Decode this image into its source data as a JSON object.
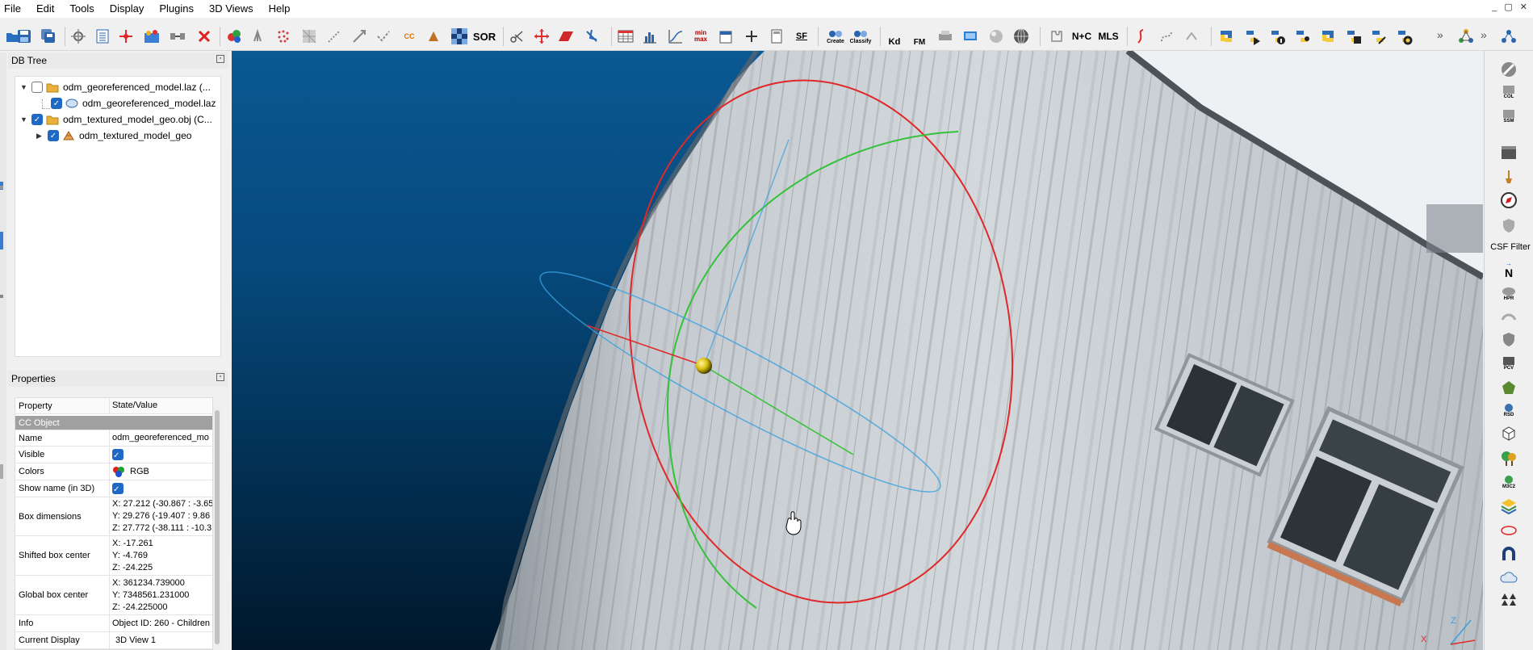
{
  "menu": [
    "File",
    "Edit",
    "Tools",
    "Display",
    "Plugins",
    "3D Views",
    "Help"
  ],
  "window_controls": "_ ▢ ✕",
  "toolbar": {
    "sor_label": "SOR",
    "cc_label": "CC",
    "sf_label": "SF",
    "canupo_create": "Create",
    "canupo_classify": "Classify",
    "kd_label": "Kd",
    "fm_label": "FM",
    "nc_label": "N+C",
    "mls_label": "MLS",
    "minmax_label": "min max",
    "more": "»"
  },
  "db_tree": {
    "title": "DB Tree",
    "items": [
      {
        "label": "odm_georeferenced_model.laz (...",
        "checked": false,
        "expanded": true
      },
      {
        "label": "odm_georeferenced_model.laz",
        "checked": true
      },
      {
        "label": "odm_textured_model_geo.obj (C...",
        "checked": true,
        "expanded": true
      },
      {
        "label": "odm_textured_model_geo",
        "checked": true,
        "expanded": false
      }
    ]
  },
  "properties": {
    "title": "Properties",
    "header": {
      "property": "Property",
      "value": "State/Value"
    },
    "section": "CC Object",
    "rows": {
      "name": {
        "label": "Name",
        "value": "odm_georeferenced_mo"
      },
      "visible": {
        "label": "Visible"
      },
      "colors": {
        "label": "Colors",
        "value": "RGB"
      },
      "show_name": {
        "label": "Show name (in 3D)"
      },
      "box_dimensions": {
        "label": "Box dimensions",
        "values": [
          "X: 27.212 (-30.867 : -3.65",
          "Y: 29.276 (-19.407 : 9.86",
          "Z: 27.772 (-38.111 : -10.3"
        ]
      },
      "shifted_center": {
        "label": "Shifted box center",
        "values": [
          "X: -17.261",
          "Y: -4.769",
          "Z: -24.225"
        ]
      },
      "global_center": {
        "label": "Global box center",
        "values": [
          "X: 361234.739000",
          "Y: 7348561.231000",
          "Z: -24.225000"
        ]
      },
      "info": {
        "label": "Info",
        "value": "Object ID: 260 - Children"
      },
      "current_display": {
        "label": "Current Display",
        "value": "3D View 1"
      }
    }
  },
  "right_toolbar": {
    "csf_label": "CSF Filter",
    "n_label": "N",
    "hpr_label": "HPR",
    "pcv_label": "PCV",
    "rsd_label": "RSD",
    "m3c2_label": "M3C2",
    "col_label": "COL",
    "ssm_label": "SSM"
  },
  "viewport": {
    "axis_x": "X",
    "axis_z": "Z",
    "colors": {
      "bg_top": "#0b5893",
      "bg_bottom": "#01182b",
      "ring_red": "#e02828",
      "ring_green": "#34c23a",
      "ring_blue": "#3aa0e0"
    }
  }
}
